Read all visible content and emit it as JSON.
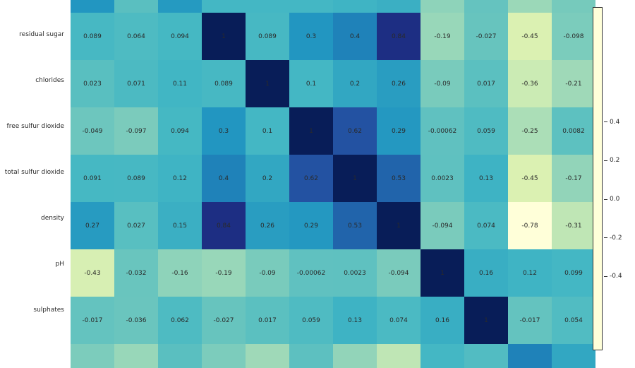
{
  "chart_data": {
    "type": "heatmap",
    "row_labels": [
      "residual sugar",
      "chlorides",
      "free sulfur dioxide",
      "total sulfur dioxide",
      "density",
      "pH",
      "sulphates"
    ],
    "matrix_labels": [
      [
        "0.089",
        "0.064",
        "0.094",
        "1",
        "0.089",
        "0.3",
        "0.4",
        "0.84",
        "-0.19",
        "-0.027",
        "-0.45",
        "-0.098"
      ],
      [
        "0.023",
        "0.071",
        "0.11",
        "0.089",
        "1",
        "0.1",
        "0.2",
        "0.26",
        "-0.09",
        "0.017",
        "-0.36",
        "-0.21"
      ],
      [
        "-0.049",
        "-0.097",
        "0.094",
        "0.3",
        "0.1",
        "1",
        "0.62",
        "0.29",
        "-0.00062",
        "0.059",
        "-0.25",
        "0.0082"
      ],
      [
        "0.091",
        "0.089",
        "0.12",
        "0.4",
        "0.2",
        "0.62",
        "1",
        "0.53",
        "0.0023",
        "0.13",
        "-0.45",
        "-0.17"
      ],
      [
        "0.27",
        "0.027",
        "0.15",
        "0.84",
        "0.26",
        "0.29",
        "0.53",
        "1",
        "-0.094",
        "0.074",
        "-0.78",
        "-0.31"
      ],
      [
        "-0.43",
        "-0.032",
        "-0.16",
        "-0.19",
        "-0.09",
        "-0.00062",
        "0.0023",
        "-0.094",
        "1",
        "0.16",
        "0.12",
        "0.099"
      ],
      [
        "-0.017",
        "-0.036",
        "0.062",
        "-0.027",
        "0.017",
        "0.059",
        "0.13",
        "0.074",
        "0.16",
        "1",
        "-0.017",
        "0.054"
      ]
    ],
    "matrix_values": [
      [
        0.089,
        0.064,
        0.094,
        1,
        0.089,
        0.3,
        0.4,
        0.84,
        -0.19,
        -0.027,
        -0.45,
        -0.098
      ],
      [
        0.023,
        0.071,
        0.11,
        0.089,
        1,
        0.1,
        0.2,
        0.26,
        -0.09,
        0.017,
        -0.36,
        -0.21
      ],
      [
        -0.049,
        -0.097,
        0.094,
        0.3,
        0.1,
        1,
        0.62,
        0.29,
        -0.00062,
        0.059,
        -0.25,
        0.0082
      ],
      [
        0.091,
        0.089,
        0.12,
        0.4,
        0.2,
        0.62,
        1,
        0.53,
        0.0023,
        0.13,
        -0.45,
        -0.17
      ],
      [
        0.27,
        0.027,
        0.15,
        0.84,
        0.26,
        0.29,
        0.53,
        1,
        -0.094,
        0.074,
        -0.78,
        -0.31
      ],
      [
        -0.43,
        -0.032,
        -0.16,
        -0.19,
        -0.09,
        -0.00062,
        0.0023,
        -0.094,
        1,
        0.16,
        0.12,
        0.099
      ],
      [
        -0.017,
        -0.036,
        0.062,
        -0.027,
        0.017,
        0.059,
        0.13,
        0.074,
        0.16,
        1,
        -0.017,
        0.054
      ]
    ],
    "extra_top_row_values": [
      0.3,
      0.02,
      0.28,
      0.1,
      0.1,
      0.1,
      0.12,
      0.15,
      -0.16,
      -0.02,
      -0.2,
      -0.08
    ],
    "extra_bottom_row_values": [
      -0.1,
      -0.19,
      0.02,
      -0.1,
      -0.21,
      0.01,
      -0.17,
      -0.31,
      0.1,
      0.05,
      0.4,
      0.2
    ],
    "vmin": -0.78,
    "vmax": 1.0,
    "colorbar_ticks": [
      -0.4,
      -0.2,
      0.0,
      0.2,
      0.4
    ],
    "colorbar_tick_labels": [
      "-0.4",
      "-0.2",
      "0.0",
      "0.2",
      "0.4"
    ],
    "colorscale": "YlGnBu"
  }
}
